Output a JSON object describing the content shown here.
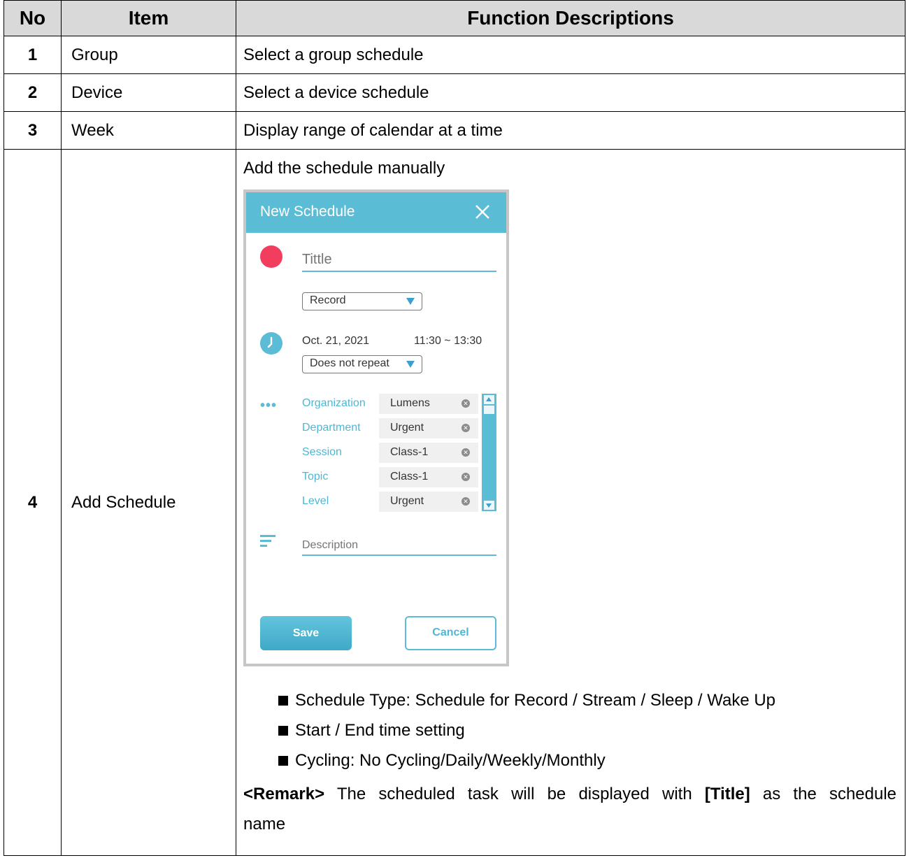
{
  "table": {
    "headers": {
      "no": "No",
      "item": "Item",
      "desc": "Function Descriptions"
    },
    "rows": [
      {
        "no": "1",
        "item": "Group",
        "desc": "Select a group schedule"
      },
      {
        "no": "2",
        "item": "Device",
        "desc": "Select a device schedule"
      },
      {
        "no": "3",
        "item": "Week",
        "desc": "Display range of calendar at a time"
      },
      {
        "no": "4",
        "item": "Add Schedule",
        "desc": "Add the schedule manually"
      }
    ]
  },
  "dialog": {
    "title": "New Schedule",
    "title_placeholder": "Tittle",
    "type_value": "Record",
    "date": "Oct. 21, 2021",
    "time": "11:30  ~  13:30",
    "repeat_value": "Does not repeat",
    "fields": [
      {
        "label": "Organization",
        "value": "Lumens"
      },
      {
        "label": "Department",
        "value": "Urgent"
      },
      {
        "label": "Session",
        "value": "Class-1"
      },
      {
        "label": "Topic",
        "value": "Class-1"
      },
      {
        "label": "Level",
        "value": "Urgent"
      }
    ],
    "description_placeholder": "Description",
    "save_label": "Save",
    "cancel_label": "Cancel",
    "colors": {
      "accent": "#5bbcd6",
      "record_dot": "#f23d5e"
    },
    "icons": [
      "close-icon",
      "record-dot-icon",
      "dropdown-arrow-icon",
      "clock-icon",
      "more-icon",
      "remove-icon",
      "description-icon",
      "scroll-up-icon",
      "scroll-down-icon"
    ]
  },
  "bullets": [
    "Schedule Type: Schedule for Record / Stream / Sleep / Wake Up",
    "Start / End time setting",
    "Cycling: No Cycling/Daily/Weekly/Monthly"
  ],
  "remark": {
    "tag": "<Remark>",
    "text_before": "The scheduled task will be displayed with",
    "bold": "[Title]",
    "text_after": "as the schedule",
    "text_last": "name"
  }
}
